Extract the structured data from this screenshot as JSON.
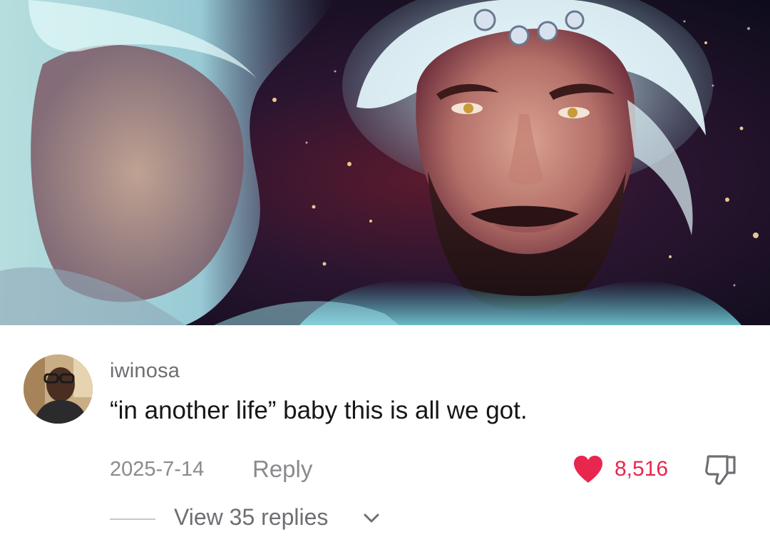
{
  "comment": {
    "username": "iwinosa",
    "text": "“in another life” baby this is all we got.",
    "date": "2025-7-14",
    "reply_label": "Reply",
    "like_count": "8,516",
    "liked": true,
    "view_replies_label": "View 35 replies"
  },
  "icons": {
    "like": "heart-icon",
    "dislike": "thumbs-down-icon",
    "expand": "chevron-down-icon"
  },
  "colors": {
    "like_active": "#e8264e",
    "secondary_text": "#8a8a8e",
    "primary_text": "#161616"
  }
}
